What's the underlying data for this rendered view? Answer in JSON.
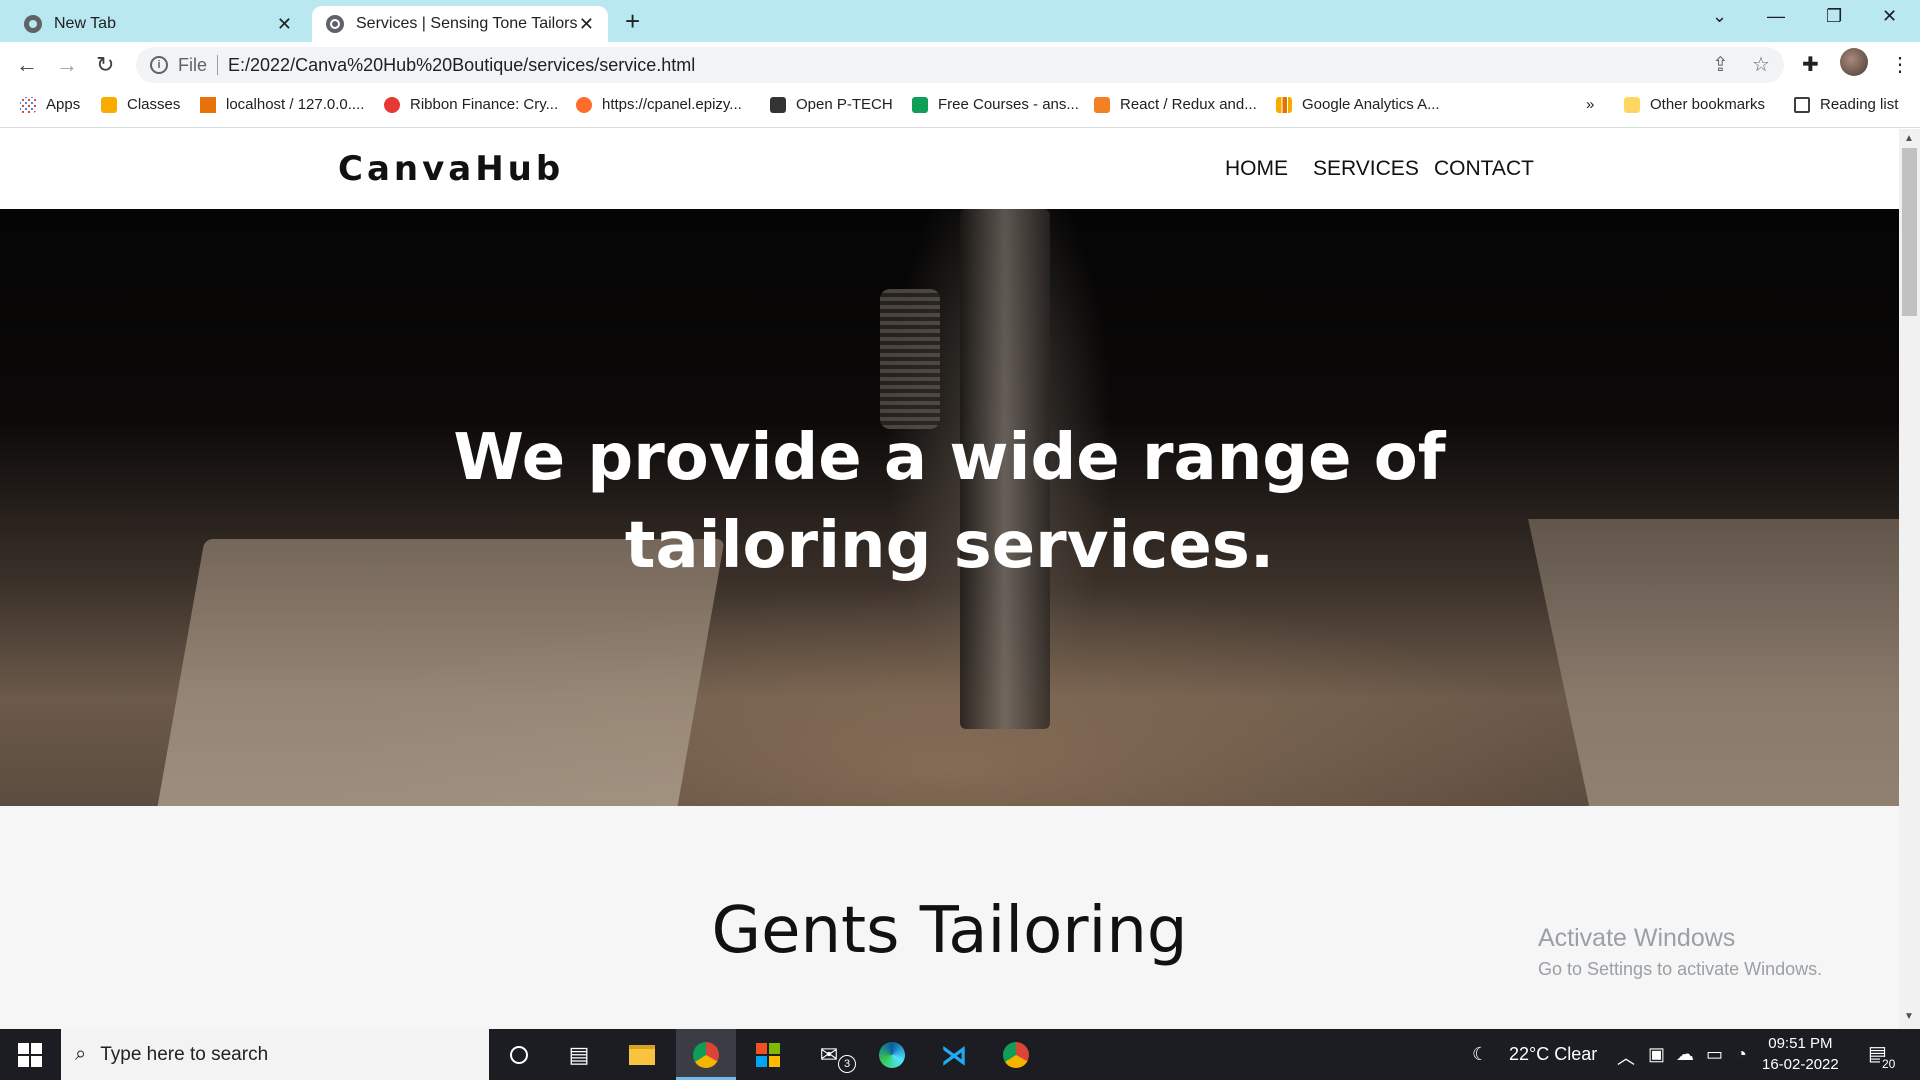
{
  "browser": {
    "tabs": [
      {
        "title": "New Tab",
        "active": false
      },
      {
        "title": "Services | Sensing Tone Tailors",
        "active": true
      }
    ],
    "address": {
      "scheme_label": "File",
      "url": "E:/2022/Canva%20Hub%20Boutique/services/service.html"
    },
    "bookmarks": [
      {
        "label": "Apps",
        "icon": "apps-grid-icon",
        "color": "#4285f4"
      },
      {
        "label": "Classes",
        "icon": "classroom-icon",
        "color": "#f9ab00"
      },
      {
        "label": "localhost / 127.0.0....",
        "icon": "phpmyadmin-icon",
        "color": "#e8710a"
      },
      {
        "label": "Ribbon Finance: Cry...",
        "icon": "ribbon-finance-icon",
        "color": "#e53935"
      },
      {
        "label": "https://cpanel.epizy...",
        "icon": "cpanel-icon",
        "color": "#ff6c2c"
      },
      {
        "label": "Open P-TECH",
        "icon": "ptech-icon",
        "color": "#333333"
      },
      {
        "label": "Free Courses - ans...",
        "icon": "courses-icon",
        "color": "#0f9d58"
      },
      {
        "label": "React / Redux and...",
        "icon": "react-redux-icon",
        "color": "#f48024"
      },
      {
        "label": "Google Analytics A...",
        "icon": "analytics-icon",
        "color": "#f9ab00"
      }
    ],
    "bookmarks_overflow": "»",
    "other_bookmarks": "Other bookmarks",
    "reading_list": "Reading list"
  },
  "site": {
    "logo": "CanvaHub",
    "nav": [
      {
        "label": "HOME"
      },
      {
        "label": "SERVICES"
      },
      {
        "label": "CONTACT"
      }
    ],
    "hero_line1": "We provide a wide range of",
    "hero_line2": "tailoring services.",
    "section_title": "Gents Tailoring"
  },
  "watermark": {
    "line1": "Activate Windows",
    "line2": "Go to Settings to activate Windows."
  },
  "taskbar": {
    "search_placeholder": "Type here to search",
    "mail_badge": "3",
    "weather": "22°C  Clear",
    "time": "09:51 PM",
    "date": "16-02-2022",
    "notifications": "20"
  }
}
